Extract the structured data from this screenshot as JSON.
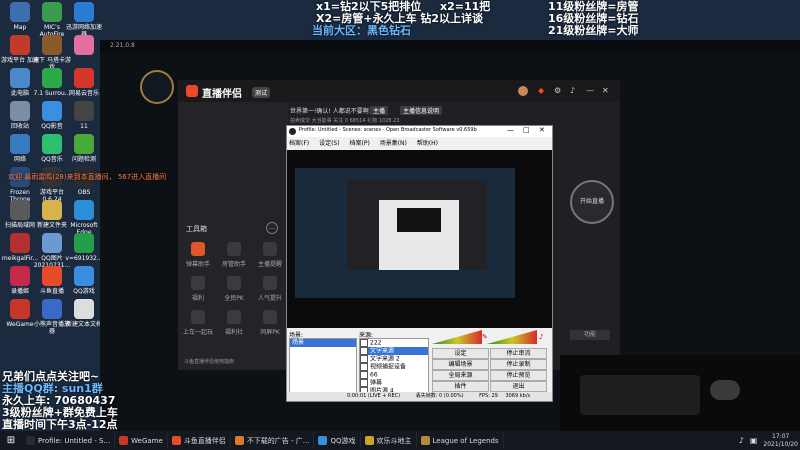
{
  "desktop": {
    "icons": [
      {
        "label": "Map",
        "color": "#3b6fb0"
      },
      {
        "label": "MIC's AutoFire",
        "color": "#3a9c4e"
      },
      {
        "label": "迅游网络加速器",
        "color": "#2a7bd1"
      },
      {
        "label": "游戏平台 加速",
        "color": "#c23b2a"
      },
      {
        "label": "原下 马塔卡游戏",
        "color": "#8a5a2b"
      },
      {
        "label": "",
        "color": "#e36fa1"
      },
      {
        "label": "此电脑",
        "color": "#4a88c9"
      },
      {
        "label": "7.1 Surrou...",
        "color": "#2aa84a"
      },
      {
        "label": "网易云音乐",
        "color": "#d4362b"
      },
      {
        "label": "回收站",
        "color": "#7a8ea6"
      },
      {
        "label": "QQ影音",
        "color": "#3b8fe0"
      },
      {
        "label": "11",
        "color": "#444"
      },
      {
        "label": "网络",
        "color": "#3a7ac1"
      },
      {
        "label": "QQ音乐",
        "color": "#2fbf71"
      },
      {
        "label": "问题检测",
        "color": "#48a838"
      },
      {
        "label": "Frozen Throne",
        "color": "#2b4a7a"
      },
      {
        "label": "游戏平台 0.6.24",
        "color": "#333"
      },
      {
        "label": "OBS",
        "color": "#2b2b2b"
      },
      {
        "label": "扫描局域网",
        "color": "#5a5a5a"
      },
      {
        "label": "新建文件夹",
        "color": "#d8b24a"
      },
      {
        "label": "Microsoft Edge",
        "color": "#2a8fd8"
      },
      {
        "label": "meikgalFir...",
        "color": "#b43030"
      },
      {
        "label": "QQ图片 20210731...",
        "color": "#6a9ad0"
      },
      {
        "label": "v=691932...",
        "color": "#23a047"
      },
      {
        "label": "录播姬",
        "color": "#c32a4a"
      },
      {
        "label": "斗鱼直播",
        "color": "#e84a2a"
      },
      {
        "label": "QQ游戏",
        "color": "#3a8ee0"
      },
      {
        "label": "WeGame",
        "color": "#c8352a"
      },
      {
        "label": "小熊声音播放器",
        "color": "#3a6ac8"
      },
      {
        "label": "新建文本文档",
        "color": "#dddddd"
      }
    ]
  },
  "overlay": {
    "top_line1": "x1=钻2以下5把排位",
    "top_line1b": "x2=11把",
    "top_line2": "X2=房管+永久上车  钻2以上详谈",
    "top_line3": "当前大区：黑色钻石",
    "right_line1": "11级粉丝牌=房管",
    "right_line2": "16级粉丝牌=钻石",
    "right_line3": "21级粉丝牌=大师",
    "welcome": "欢迎 暴雨雷鸣(28)来到本直播间， 567进入直播间",
    "left_lines": [
      "兄弟们点点关注吧~",
      "主播QQ群: sun1群",
      "永久上车: 70680437",
      "3级粉丝牌+群免费上车",
      "直播时间下午3点-12点"
    ]
  },
  "douyu_window": {
    "title": "斗鱼直播伴侣 2.21.0.8",
    "brand": "直播伴侣",
    "badge": "测试",
    "promo": "世界第一!确认!  人都说不要啊！",
    "tag1": "主播",
    "tag2": "主播信息说明",
    "stat1": "拍卖成交",
    "stat2": "大当能事",
    "stat3": "关注 0",
    "stat4": "68514",
    "stat5": "礼物",
    "stat6": "1028.23",
    "toolbox_title": "工具箱",
    "tools": [
      {
        "label": "弹幕助手",
        "color": "#e0552a"
      },
      {
        "label": "房管助手",
        "color": "#3a3a3f"
      },
      {
        "label": "主播提醒",
        "color": "#3a3a3f"
      },
      {
        "label": "福利",
        "color": "#3a3a3f"
      },
      {
        "label": "全民PK",
        "color": "#3a3a3f"
      },
      {
        "label": "人气提升",
        "color": "#3a3a3f"
      },
      {
        "label": "上车一起玩",
        "color": "#3a3a3f"
      },
      {
        "label": "福利社",
        "color": "#3a3a3f"
      },
      {
        "label": "同屏PK",
        "color": "#3a3a3f"
      }
    ],
    "footer": "斗鱼直播伴侣使用指南",
    "go_live": "开始直播",
    "hint": "功能",
    "exit": "退出",
    "toolbox_more": "更多"
  },
  "obs": {
    "title": "Profile: Untitled - Scenes: scenes - Open Broadcaster Software v0.659b",
    "menu": [
      "档案(F)",
      "设定(S)",
      "档案(P)",
      "场景集(N)",
      "帮助(H)"
    ],
    "scenes_label": "场景:",
    "sources_label": "来源:",
    "scene_items": [
      "场景"
    ],
    "source_items": [
      "222",
      "文字来源",
      "文字来源 2",
      "视频捕捉设备",
      "66",
      "弹幕",
      "图片源 4"
    ],
    "buttons_left": [
      "设定",
      "编辑场景",
      "全局来源",
      "插件"
    ],
    "buttons_right": [
      "停止串流",
      "停止录制",
      "停止预览",
      "退出"
    ],
    "status": "0:00:01 (LIVE + REC)",
    "status2": "丢失帧数: 0 (0.00%)",
    "status3": "FPS: 29",
    "status4": "3069 kb/s"
  },
  "taskbar": {
    "items": [
      {
        "label": "Profile: Untitled - S...",
        "color": "#2b2b2b"
      },
      {
        "label": "WeGame",
        "color": "#c8352a"
      },
      {
        "label": "斗鱼直播伴侣",
        "color": "#e84a2a"
      },
      {
        "label": "不下载的广告 - 广...",
        "color": "#e0782a"
      },
      {
        "label": "QQ游戏",
        "color": "#3a8ee0"
      },
      {
        "label": "欢乐斗地主",
        "color": "#c8a52a"
      },
      {
        "label": "League of Legends",
        "color": "#b38b3a"
      }
    ],
    "clock": "17:07",
    "date": "2021/10/20"
  }
}
